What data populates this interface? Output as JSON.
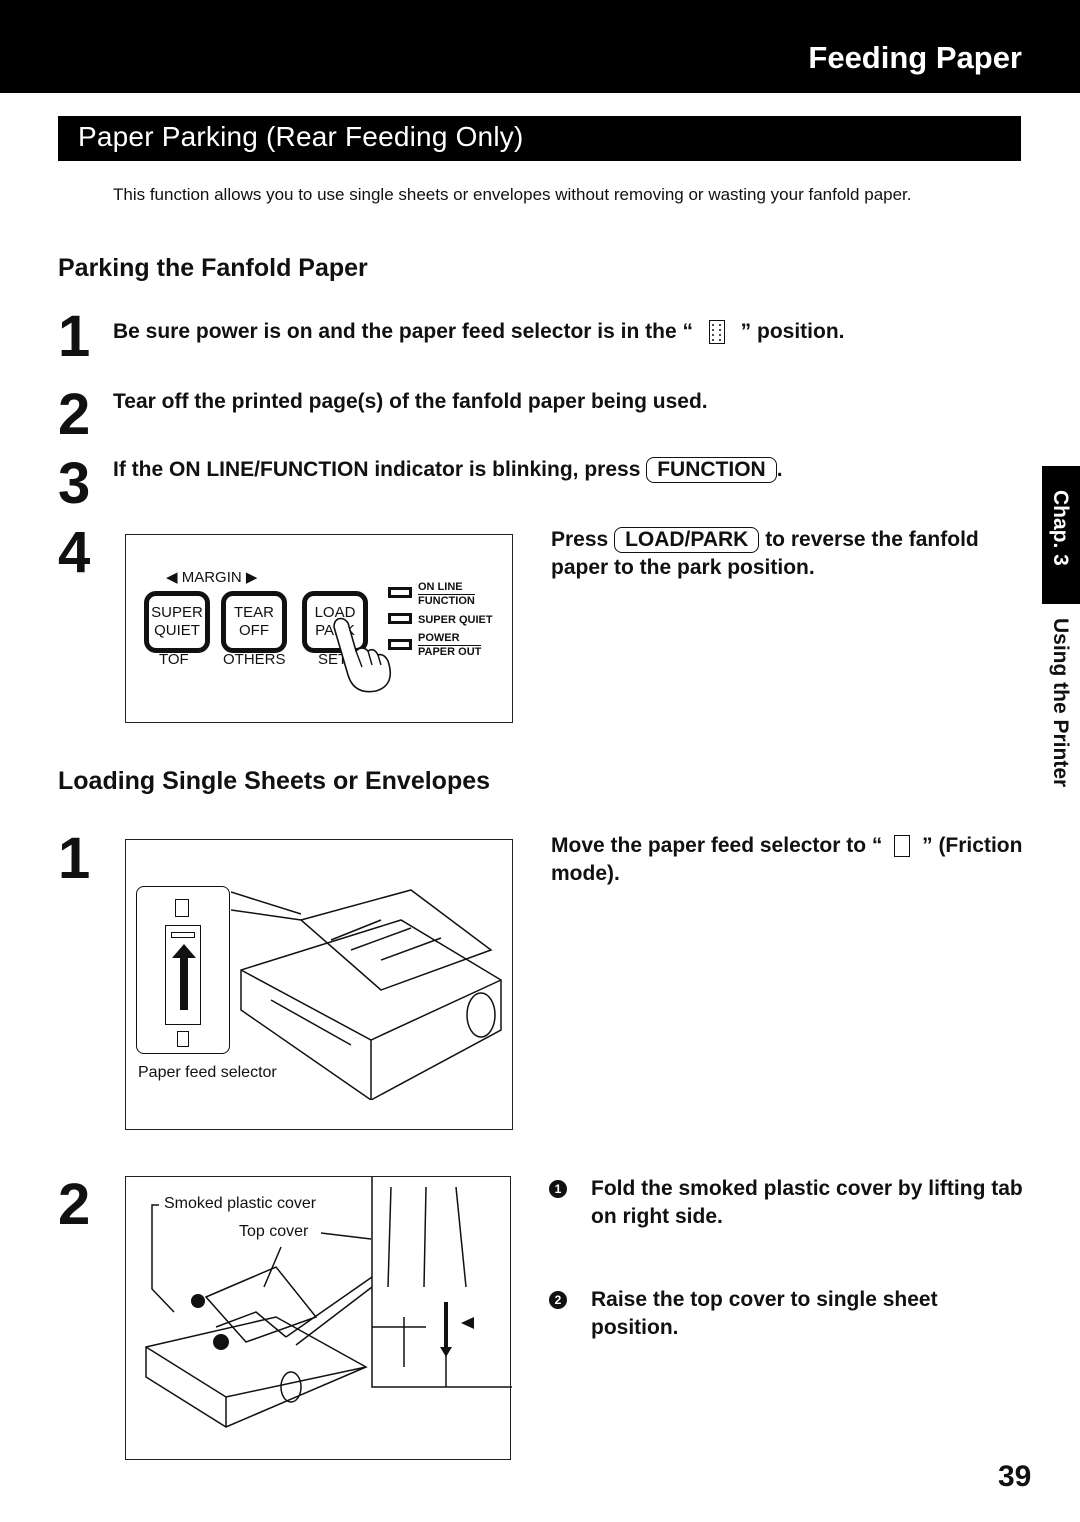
{
  "header": {
    "title": "Feeding Paper"
  },
  "section": {
    "title": "Paper Parking (Rear Feeding Only)",
    "intro": "This function allows you to use single sheets or envelopes without removing or wasting your fanfold paper."
  },
  "parking": {
    "heading": "Parking the Fanfold Paper",
    "steps": [
      {
        "num": "1",
        "text_before": "Be sure power is on and the paper feed selector is in the “",
        "icon": "tractor-feed-icon",
        "text_after": "” position."
      },
      {
        "num": "2",
        "text": "Tear off the printed page(s) of the fanfold paper being used."
      },
      {
        "num": "3",
        "text_before": "If the ON LINE/FUNCTION indicator is blinking, press",
        "key": "FUNCTION",
        "text_after": "."
      },
      {
        "num": "4",
        "text_before": "Press",
        "key": "LOAD/PARK",
        "text_after": "to reverse the fanfold paper to the park position."
      }
    ],
    "panel": {
      "margin_label": "MARGIN",
      "keys": [
        {
          "top": "SUPER",
          "bottom": "QUIET",
          "sub": "TOF"
        },
        {
          "top": "TEAR",
          "bottom": "OFF",
          "sub": "OTHERS"
        },
        {
          "top": "LOAD",
          "bottom": "PARK",
          "sub": "SET"
        }
      ],
      "indicators": [
        {
          "top": "ON LINE",
          "bottom": "FUNCTION"
        },
        {
          "top": "SUPER QUIET",
          "bottom": ""
        },
        {
          "top": "POWER",
          "bottom": "PAPER OUT"
        }
      ]
    }
  },
  "loading": {
    "heading": "Loading Single Sheets or Envelopes",
    "step1": {
      "num": "1",
      "text_before": "Move the paper feed selector to “",
      "icon": "friction-sheet-icon",
      "text_after": "” (Friction mode).",
      "caption": "Paper feed selector"
    },
    "step2": {
      "num": "2",
      "labels": {
        "smoked": "Smoked plastic cover",
        "top": "Top cover"
      },
      "items": [
        {
          "bullet": "1",
          "text": "Fold the smoked plastic cover by lifting tab on right side."
        },
        {
          "bullet": "2",
          "text": "Raise the top cover to single sheet position."
        }
      ]
    }
  },
  "side_tab": {
    "chapter": "Chap. 3",
    "title": "Using the Printer"
  },
  "page_number": "39"
}
